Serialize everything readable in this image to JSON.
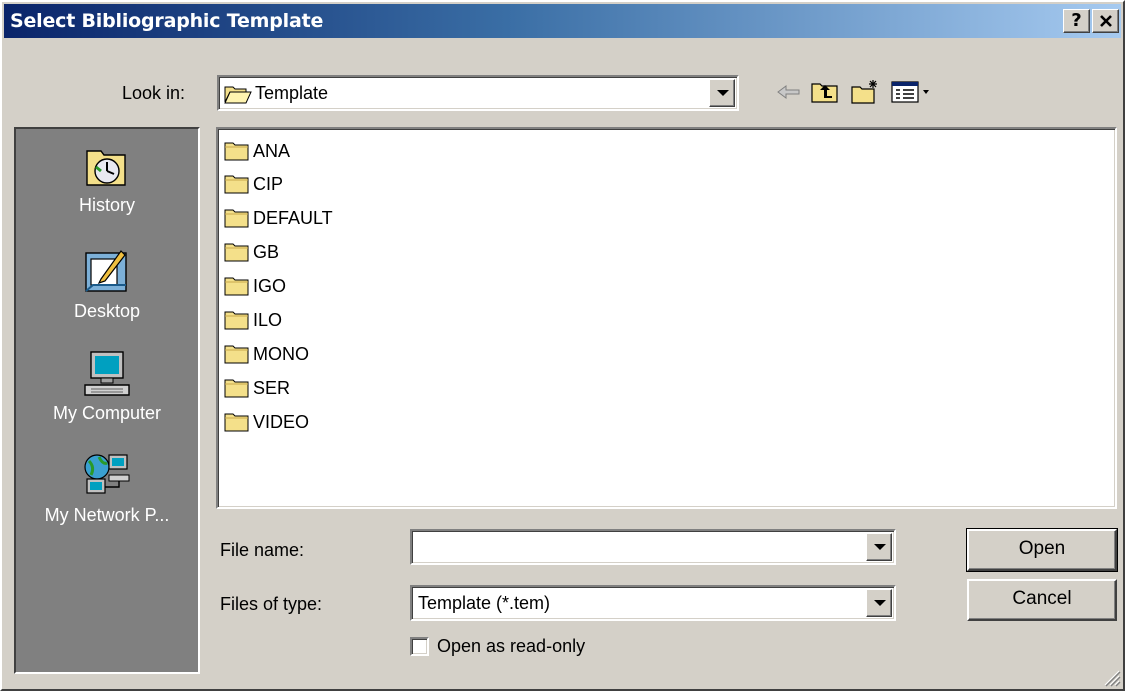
{
  "window": {
    "title": "Select Bibliographic Template",
    "help_label": "?",
    "close_label": "✕"
  },
  "look_in": {
    "label": "Look in:",
    "value": "Template"
  },
  "toolbar": {
    "icons": [
      "back-arrow-icon",
      "up-one-level-icon",
      "new-folder-icon",
      "view-menu-icon"
    ]
  },
  "places": [
    {
      "label": "History",
      "icon": "history-icon"
    },
    {
      "label": "Desktop",
      "icon": "desktop-icon"
    },
    {
      "label": "My Computer",
      "icon": "my-computer-icon"
    },
    {
      "label": "My Network P...",
      "icon": "network-places-icon"
    }
  ],
  "files": [
    "ANA",
    "CIP",
    "DEFAULT",
    "GB",
    "IGO",
    "ILO",
    "MONO",
    "SER",
    "VIDEO"
  ],
  "file_name": {
    "label": "File name:",
    "value": ""
  },
  "files_of_type": {
    "label": "Files of type:",
    "value": "Template (*.tem)"
  },
  "read_only": {
    "label": "Open as read-only",
    "checked": false
  },
  "buttons": {
    "open": "Open",
    "cancel": "Cancel"
  },
  "colors": {
    "title_start": "#0a246a",
    "title_end": "#a6caf0",
    "face": "#d4d0c8",
    "places_bar": "#808080",
    "folder": "#f4e08a"
  }
}
